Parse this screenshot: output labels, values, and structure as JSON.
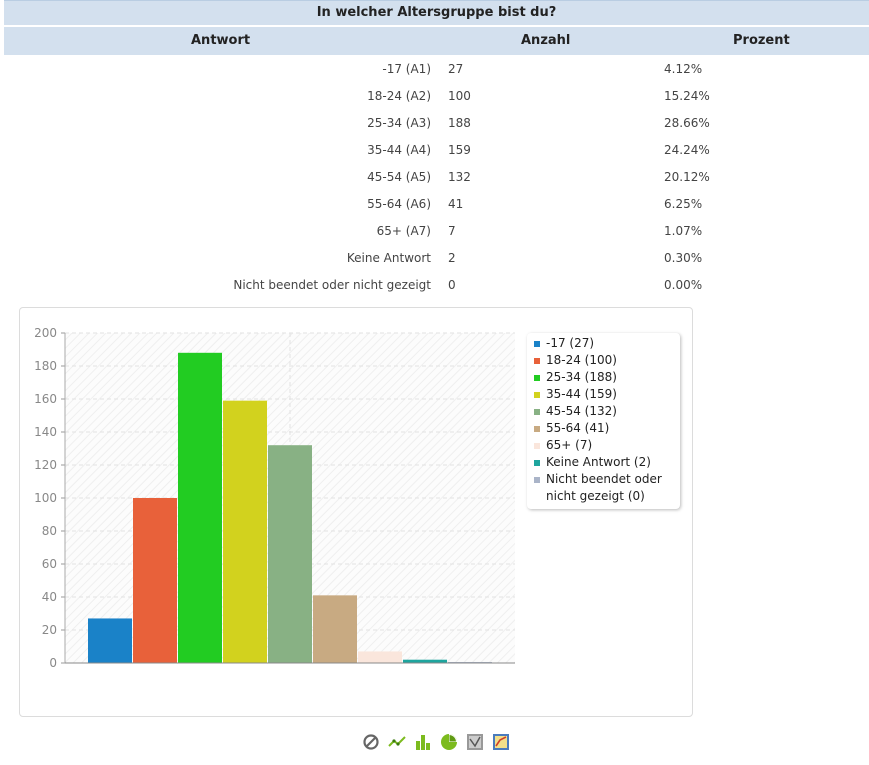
{
  "title": "In welcher Altersgruppe bist du?",
  "table": {
    "headers": {
      "answer": "Antwort",
      "count": "Anzahl",
      "percent": "Prozent"
    },
    "rows": [
      {
        "label": "-17 (A1)",
        "count": "27",
        "percent": "4.12%"
      },
      {
        "label": "18-24 (A2)",
        "count": "100",
        "percent": "15.24%"
      },
      {
        "label": "25-34 (A3)",
        "count": "188",
        "percent": "28.66%"
      },
      {
        "label": "35-44 (A4)",
        "count": "159",
        "percent": "24.24%"
      },
      {
        "label": "45-54 (A5)",
        "count": "132",
        "percent": "20.12%"
      },
      {
        "label": "55-64 (A6)",
        "count": "41",
        "percent": "6.25%"
      },
      {
        "label": "65+ (A7)",
        "count": "7",
        "percent": "1.07%"
      },
      {
        "label": "Keine Antwort",
        "count": "2",
        "percent": "0.30%"
      },
      {
        "label": "Nicht beendet oder nicht gezeigt",
        "count": "0",
        "percent": "0.00%"
      }
    ]
  },
  "chart_data": {
    "type": "bar",
    "categories": [
      "-17",
      "18-24",
      "25-34",
      "35-44",
      "45-54",
      "55-64",
      "65+",
      "Keine Antwort",
      "Nicht beendet oder nicht gezeigt"
    ],
    "values": [
      27,
      100,
      188,
      159,
      132,
      41,
      7,
      2,
      0
    ],
    "colors": [
      "#1a82c8",
      "#e8613a",
      "#22cc22",
      "#d2d21e",
      "#88b184",
      "#c8aa82",
      "#fae6dc",
      "#1ea59e",
      "#aab4c8"
    ],
    "ylim": [
      0,
      200
    ],
    "yticks": [
      "0",
      "20",
      "40",
      "60",
      "80",
      "100",
      "120",
      "140",
      "160",
      "180",
      "200"
    ],
    "grid": true,
    "legend_position": "right",
    "legend": [
      "-17 (27)",
      "18-24 (100)",
      "25-34 (188)",
      "35-44 (159)",
      "45-54 (132)",
      "55-64 (41)",
      "65+ (7)",
      "Keine Antwort (2)",
      "Nicht beendet oder nicht gezeigt (0)"
    ]
  },
  "toolbar": {
    "icons": [
      "disable-chart-icon",
      "line-chart-icon",
      "bar-chart-icon",
      "pie-chart-icon",
      "radar-chart-icon",
      "polar-chart-icon"
    ]
  }
}
